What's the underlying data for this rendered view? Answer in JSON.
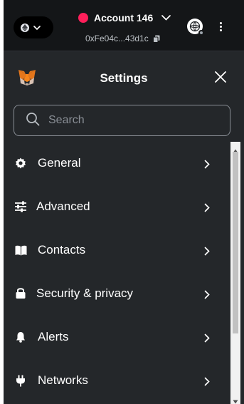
{
  "header": {
    "account_name": "Account 146",
    "address": "0xFe04c...43d1c",
    "colors": {
      "account_avatar": "#ff1f5a",
      "topbar_bg": "#141618",
      "panel_bg": "#24272a"
    }
  },
  "settings": {
    "title": "Settings",
    "search": {
      "placeholder": "Search",
      "value": ""
    },
    "items": [
      {
        "label": "General",
        "icon": "gear-icon"
      },
      {
        "label": "Advanced",
        "icon": "sliders-icon"
      },
      {
        "label": "Contacts",
        "icon": "book-icon"
      },
      {
        "label": "Security & privacy",
        "icon": "lock-icon"
      },
      {
        "label": "Alerts",
        "icon": "bell-icon"
      },
      {
        "label": "Networks",
        "icon": "plug-icon"
      }
    ]
  }
}
